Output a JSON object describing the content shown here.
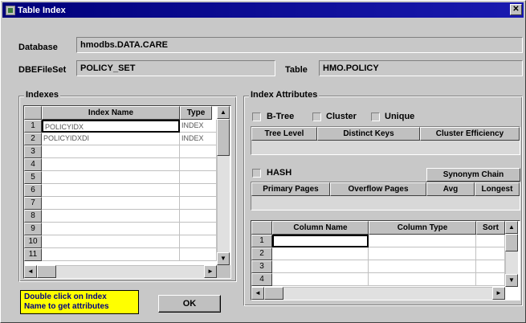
{
  "window": {
    "title": "Table Index",
    "close_glyph": "✕"
  },
  "fields": {
    "database_label": "Database",
    "database_value": "hmodbs.DATA.CARE",
    "dbefileset_label": "DBEFileSet",
    "dbefileset_value": "POLICY_SET",
    "table_label": "Table",
    "table_value": "HMO.POLICY"
  },
  "indexes": {
    "title": "Indexes",
    "columns": [
      "Index Name",
      "Type"
    ],
    "rows": [
      {
        "num": "1",
        "name": "POLICYIDX",
        "type": "INDEX"
      },
      {
        "num": "2",
        "name": "POLICYIDXDI",
        "type": "INDEX"
      },
      {
        "num": "3",
        "name": "",
        "type": ""
      },
      {
        "num": "4",
        "name": "",
        "type": ""
      },
      {
        "num": "5",
        "name": "",
        "type": ""
      },
      {
        "num": "6",
        "name": "",
        "type": ""
      },
      {
        "num": "7",
        "name": "",
        "type": ""
      },
      {
        "num": "8",
        "name": "",
        "type": ""
      },
      {
        "num": "9",
        "name": "",
        "type": ""
      },
      {
        "num": "10",
        "name": "",
        "type": ""
      },
      {
        "num": "11",
        "name": "",
        "type": ""
      }
    ]
  },
  "attributes": {
    "title": "Index Attributes",
    "btree_label": "B-Tree",
    "cluster_label": "Cluster",
    "unique_label": "Unique",
    "btree_cols": [
      "Tree Level",
      "Distinct Keys",
      "Cluster Efficiency"
    ],
    "hash_label": "HASH",
    "synonym_chain_label": "Synonym Chain",
    "hash_cols": [
      "Primary Pages",
      "Overflow Pages",
      "Avg",
      "Longest"
    ],
    "column_grid_cols": [
      "Column Name",
      "Column Type",
      "Sort"
    ],
    "column_rows": [
      "1",
      "2",
      "3",
      "4"
    ]
  },
  "hint_text_line1": "Double click on Index",
  "hint_text_line2": "Name to get attributes",
  "ok_label": "OK",
  "icons": {
    "scroll_up": "▲",
    "scroll_down": "▼",
    "scroll_left": "◄",
    "scroll_right": "►"
  }
}
